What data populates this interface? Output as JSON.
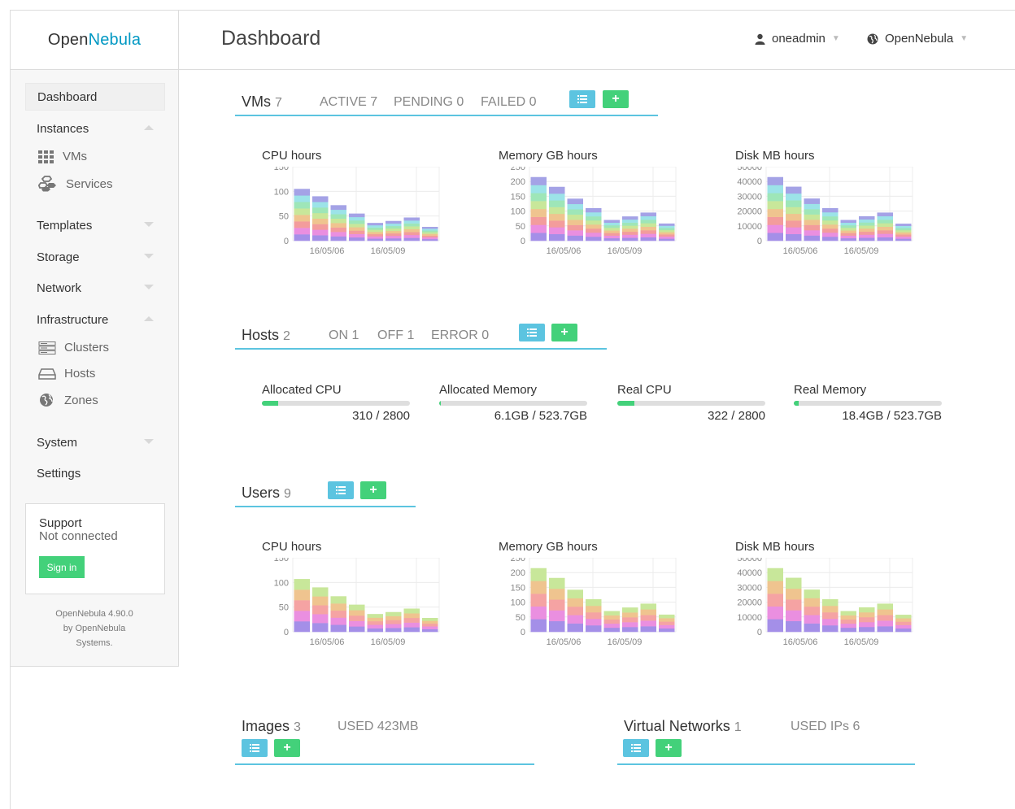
{
  "brand": {
    "part1": "Open",
    "part2": "Nebula"
  },
  "header": {
    "title": "Dashboard",
    "user": "oneadmin",
    "zone": "OpenNebula"
  },
  "sidebar": {
    "dashboard": "Dashboard",
    "instances": "Instances",
    "vms": "VMs",
    "services": "Services",
    "templates": "Templates",
    "storage": "Storage",
    "network": "Network",
    "infrastructure": "Infrastructure",
    "clusters": "Clusters",
    "hosts": "Hosts",
    "zones": "Zones",
    "system": "System",
    "settings": "Settings"
  },
  "support": {
    "title": "Support",
    "status": "Not connected",
    "button": "Sign in"
  },
  "version": {
    "line1": "OpenNebula 4.90.0",
    "line2": "by OpenNebula",
    "line3": "Systems."
  },
  "vms": {
    "title": "VMs",
    "count": "7",
    "active": "ACTIVE 7",
    "pending": "PENDING 0",
    "failed": "FAILED 0"
  },
  "hosts": {
    "title": "Hosts",
    "count": "2",
    "on": "ON 1",
    "off": "OFF 1",
    "error": "ERROR 0"
  },
  "users": {
    "title": "Users",
    "count": "9"
  },
  "images": {
    "title": "Images",
    "count": "3",
    "used": "USED 423MB"
  },
  "vnets": {
    "title": "Virtual Networks",
    "count": "1",
    "used": "USED IPs 6"
  },
  "meters": [
    {
      "label": "Allocated CPU",
      "value": "310 / 2800",
      "fraction": 0.11
    },
    {
      "label": "Allocated Memory",
      "value": "6.1GB / 523.7GB",
      "fraction": 0.012
    },
    {
      "label": "Real CPU",
      "value": "322 / 2800",
      "fraction": 0.115
    },
    {
      "label": "Real Memory",
      "value": "18.4GB / 523.7GB",
      "fraction": 0.035
    }
  ],
  "colors": {
    "vm": [
      "#a48fe8",
      "#ea8fe0",
      "#f39c9c",
      "#efc48f",
      "#c8e79a",
      "#9ee6b8",
      "#9ce3e8",
      "#a4a2e6"
    ],
    "user": [
      "#a48fe8",
      "#ea8fe0",
      "#f5a3a3",
      "#efc48f",
      "#c8e79a"
    ]
  },
  "chart_data": [
    {
      "type": "bar",
      "title": "CPU hours",
      "yticks": [
        "150",
        "100",
        "50",
        "0"
      ],
      "ylim": [
        0,
        150
      ],
      "xticks": [
        "16/05/06",
        "16/05/09"
      ],
      "values": [
        105,
        90,
        72,
        55,
        36,
        40,
        47,
        28
      ]
    },
    {
      "type": "bar",
      "title": "Memory GB hours",
      "yticks": [
        "250",
        "200",
        "150",
        "100",
        "50",
        "0"
      ],
      "ylim": [
        0,
        250
      ],
      "xticks": [
        "16/05/06",
        "16/05/09"
      ],
      "values": [
        215,
        182,
        142,
        110,
        70,
        82,
        95,
        58
      ]
    },
    {
      "type": "bar",
      "title": "Disk MB hours",
      "yticks": [
        "50000",
        "40000",
        "30000",
        "20000",
        "10000",
        "0"
      ],
      "ylim": [
        0,
        50000
      ],
      "xticks": [
        "16/05/06",
        "16/05/09"
      ],
      "values": [
        43000,
        36500,
        28500,
        22000,
        14000,
        16500,
        19000,
        11500
      ]
    },
    {
      "type": "bar",
      "title": "CPU hours",
      "yticks": [
        "150",
        "100",
        "50",
        "0"
      ],
      "ylim": [
        0,
        150
      ],
      "xticks": [
        "16/05/06",
        "16/05/09"
      ],
      "values": [
        107,
        90,
        72,
        55,
        36,
        40,
        47,
        28
      ]
    },
    {
      "type": "bar",
      "title": "Memory GB hours",
      "yticks": [
        "250",
        "200",
        "150",
        "100",
        "50",
        "0"
      ],
      "ylim": [
        0,
        250
      ],
      "xticks": [
        "16/05/06",
        "16/05/09"
      ],
      "values": [
        215,
        182,
        142,
        110,
        70,
        82,
        95,
        58
      ]
    },
    {
      "type": "bar",
      "title": "Disk MB hours",
      "yticks": [
        "50000",
        "40000",
        "30000",
        "20000",
        "10000",
        "0"
      ],
      "ylim": [
        0,
        50000
      ],
      "xticks": [
        "16/05/06",
        "16/05/09"
      ],
      "values": [
        43000,
        36500,
        28500,
        22000,
        14000,
        16500,
        19000,
        11500
      ]
    }
  ]
}
